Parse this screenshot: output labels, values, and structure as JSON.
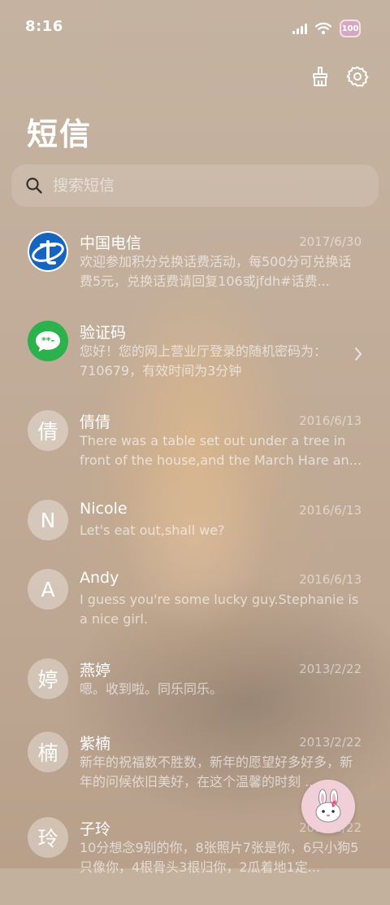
{
  "status_bar": {
    "time": "8:16",
    "battery": "100"
  },
  "header": {
    "title": "短信",
    "clean_icon": "broom-icon",
    "settings_icon": "gear-icon"
  },
  "search": {
    "placeholder": "搜索短信"
  },
  "conversations": [
    {
      "name": "中国电信",
      "date": "2017/6/30",
      "preview": "欢迎参加积分兑换话费活动，每500分可兑换话费5元，兑换话费请回复106或jfdh#话费...",
      "avatar_type": "china-telecom-logo-icon"
    },
    {
      "name": "验证码",
      "date": "",
      "preview": "您好！您的网上营业厅登录的随机密码为：710679，有效时间为3分钟",
      "avatar_type": "message-bubble-icon"
    },
    {
      "name": "倩倩",
      "date": "2016/6/13",
      "preview": "There was a table set out under a tree in front of the house,and the March Hare an...",
      "avatar": "倩"
    },
    {
      "name": "Nicole",
      "date": "2016/6/13",
      "preview": "Let's eat out,shall we?",
      "avatar": "N"
    },
    {
      "name": "Andy",
      "date": "2016/6/13",
      "preview": "I guess you're some lucky guy.Stephanie is a nice girl.",
      "avatar": "A"
    },
    {
      "name": "燕婷",
      "date": "2013/2/22",
      "preview": "嗯。收到啦。同乐同乐。",
      "avatar": "婷"
    },
    {
      "name": "紫楠",
      "date": "2013/2/22",
      "preview": "新年的祝福数不胜数，新年的愿望好多好多，新年的问候依旧美好，在这个温馨的时刻 ...",
      "avatar": "楠"
    },
    {
      "name": "子玲",
      "date": "2013/2/22",
      "preview": "10分想念9别的你，8张照片7张是你，6只小狗5只像你，4根骨头3根归你，2瓜着地1定...",
      "avatar": "玲"
    }
  ],
  "colors": {
    "telecom_blue": "#1565c0",
    "sms_green": "#2bb24c",
    "fab_pink": "#f1cfd8"
  },
  "fab": {
    "icon": "bunny-icon"
  }
}
